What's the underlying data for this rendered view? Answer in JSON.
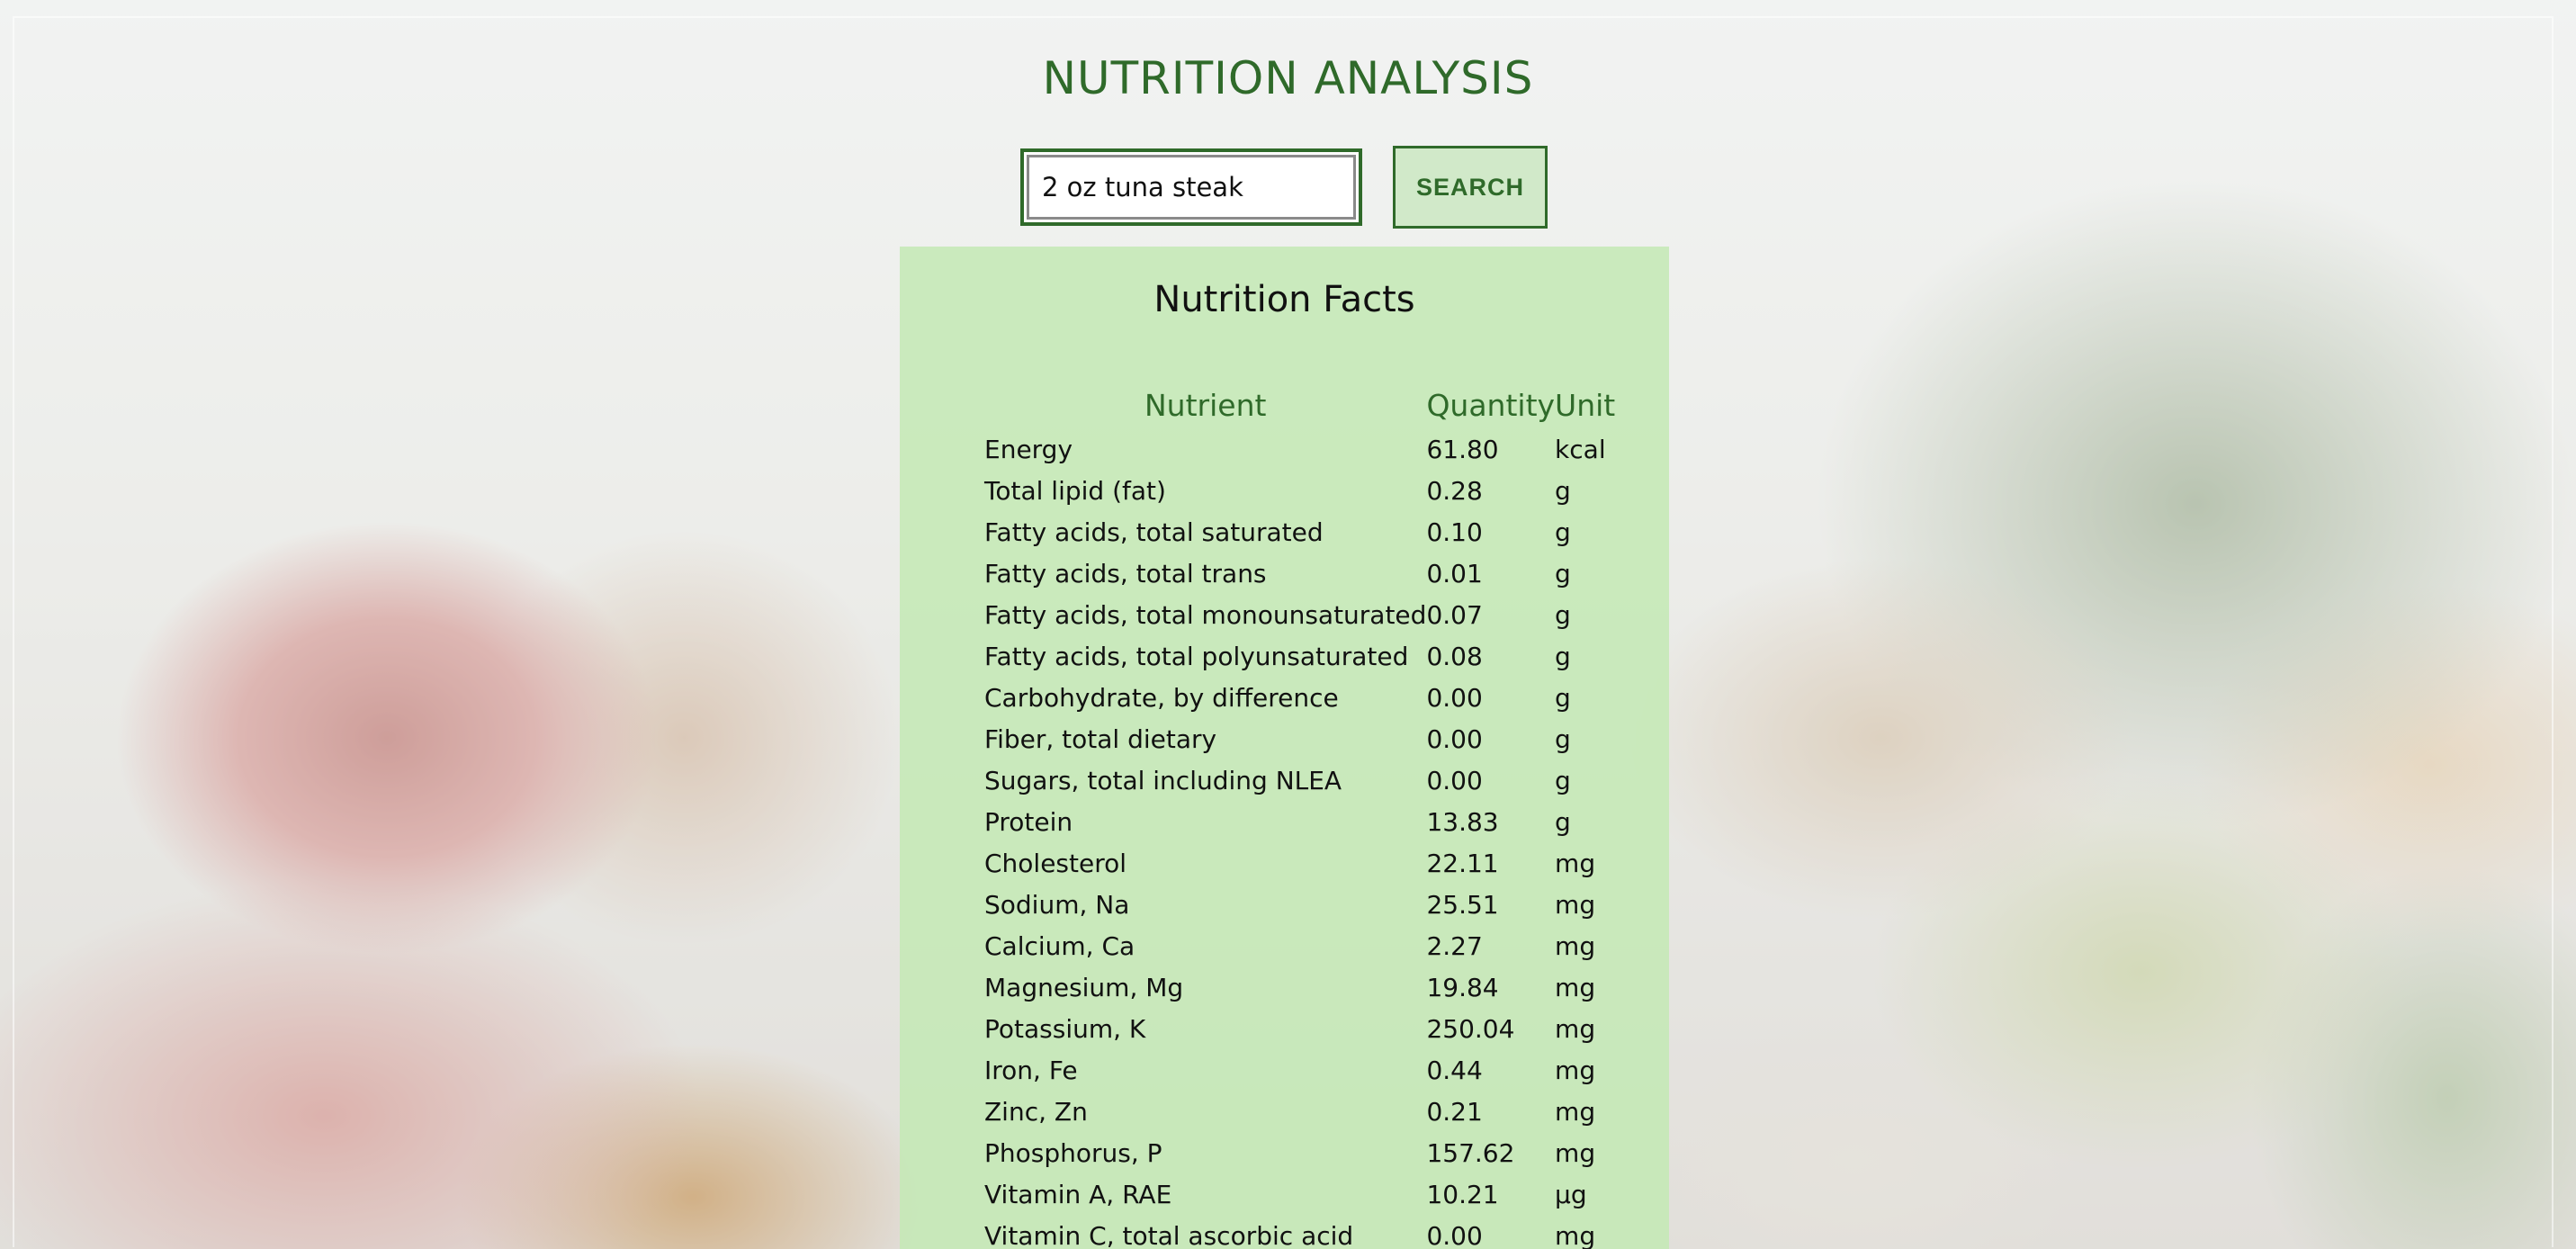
{
  "header": {
    "title": "NUTRITION ANALYSIS"
  },
  "search": {
    "value": "2 oz tuna steak",
    "button_label": "SEARCH"
  },
  "facts": {
    "title": "Nutrition Facts",
    "columns": [
      "Nutrient",
      "Quantity",
      "Unit"
    ],
    "rows": [
      {
        "nutrient": "Energy",
        "quantity": "61.80",
        "unit": "kcal"
      },
      {
        "nutrient": "Total lipid (fat)",
        "quantity": "0.28",
        "unit": "g"
      },
      {
        "nutrient": "Fatty acids, total saturated",
        "quantity": "0.10",
        "unit": "g"
      },
      {
        "nutrient": "Fatty acids, total trans",
        "quantity": "0.01",
        "unit": "g"
      },
      {
        "nutrient": "Fatty acids, total monounsaturated",
        "quantity": "0.07",
        "unit": "g"
      },
      {
        "nutrient": "Fatty acids, total polyunsaturated",
        "quantity": "0.08",
        "unit": "g"
      },
      {
        "nutrient": "Carbohydrate, by difference",
        "quantity": "0.00",
        "unit": "g"
      },
      {
        "nutrient": "Fiber, total dietary",
        "quantity": "0.00",
        "unit": "g"
      },
      {
        "nutrient": "Sugars, total including NLEA",
        "quantity": "0.00",
        "unit": "g"
      },
      {
        "nutrient": "Protein",
        "quantity": "13.83",
        "unit": "g"
      },
      {
        "nutrient": "Cholesterol",
        "quantity": "22.11",
        "unit": "mg"
      },
      {
        "nutrient": "Sodium, Na",
        "quantity": "25.51",
        "unit": "mg"
      },
      {
        "nutrient": "Calcium, Ca",
        "quantity": "2.27",
        "unit": "mg"
      },
      {
        "nutrient": "Magnesium, Mg",
        "quantity": "19.84",
        "unit": "mg"
      },
      {
        "nutrient": "Potassium, K",
        "quantity": "250.04",
        "unit": "mg"
      },
      {
        "nutrient": "Iron, Fe",
        "quantity": "0.44",
        "unit": "mg"
      },
      {
        "nutrient": "Zinc, Zn",
        "quantity": "0.21",
        "unit": "mg"
      },
      {
        "nutrient": "Phosphorus, P",
        "quantity": "157.62",
        "unit": "mg"
      },
      {
        "nutrient": "Vitamin A, RAE",
        "quantity": "10.21",
        "unit": "µg"
      },
      {
        "nutrient": "Vitamin C, total ascorbic acid",
        "quantity": "0.00",
        "unit": "mg"
      }
    ]
  },
  "colors": {
    "accent": "#2f6a2a",
    "panel": "#c4e9b4"
  }
}
